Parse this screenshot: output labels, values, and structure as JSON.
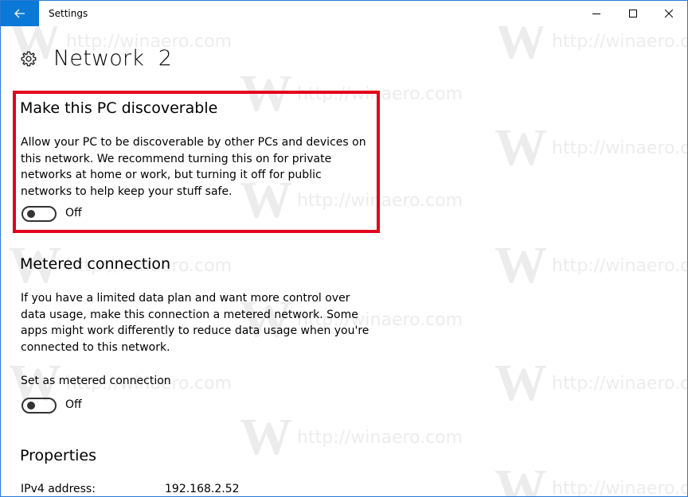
{
  "window": {
    "title": "Settings"
  },
  "header": {
    "title": "Network  2",
    "icon": "gear-icon"
  },
  "discoverable": {
    "title": "Make this PC discoverable",
    "description": "Allow your PC to be discoverable by other PCs and devices on this network. We recommend turning this on for private networks at home or work, but turning it off for public networks to help keep your stuff safe.",
    "toggle_state": "Off"
  },
  "metered": {
    "title": "Metered connection",
    "description": "If you have a limited data plan and want more control over data usage, make this connection a metered network. Some apps might work differently to reduce data usage when you're connected to this network.",
    "setting_label": "Set as metered connection",
    "toggle_state": "Off"
  },
  "properties": {
    "title": "Properties",
    "rows": [
      {
        "label": "IPv4 address:",
        "value": "192.168.2.52"
      }
    ]
  },
  "watermark": {
    "letter": "W",
    "text": "http://winaero.com"
  },
  "colors": {
    "accent": "#0a78d7",
    "highlight": "#e3001b"
  }
}
